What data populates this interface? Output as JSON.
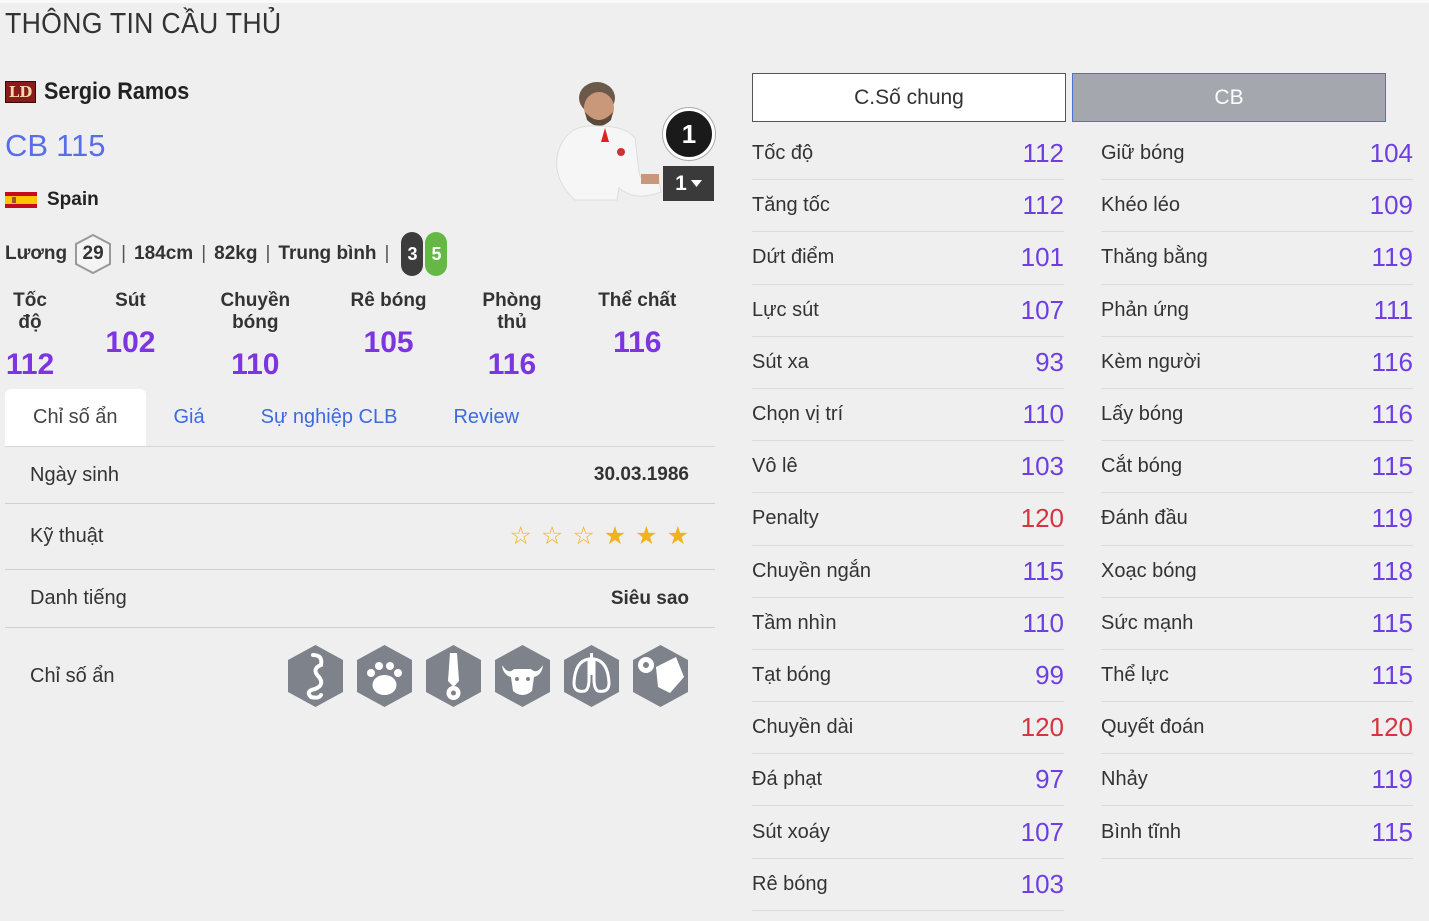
{
  "page_title": "THÔNG TIN CẦU THỦ",
  "player": {
    "season_badge": "LD",
    "name": "Sergio Ramos",
    "position": "CB",
    "ovr": "115",
    "nation": "Spain",
    "wage_label": "Lương",
    "wage": "29",
    "height": "184cm",
    "weight": "82kg",
    "build": "Trung bình",
    "left_foot": "3",
    "right_foot": "5",
    "grade": "1",
    "grade_select": "1"
  },
  "summary": [
    {
      "label": "Tốc độ",
      "value": "112"
    },
    {
      "label": "Sút",
      "value": "102"
    },
    {
      "label": "Chuyền bóng",
      "value": "110"
    },
    {
      "label": "Rê bóng",
      "value": "105"
    },
    {
      "label": "Phòng thủ",
      "value": "116"
    },
    {
      "label": "Thể chất",
      "value": "116"
    }
  ],
  "tabs": [
    "Chỉ số ẩn",
    "Giá",
    "Sự nghiệp CLB",
    "Review"
  ],
  "details": {
    "birth_label": "Ngày sinh",
    "birth_value": "30.03.1986",
    "skill_label": "Kỹ thuật",
    "skill_stars": 3,
    "skill_max": 6,
    "fame_label": "Danh tiếng",
    "fame_value": "Siêu sao",
    "traits_label": "Chỉ số ẩn",
    "traits": [
      "snake-trait-icon",
      "paw-trait-icon",
      "tie-ball-trait-icon",
      "bison-trait-icon",
      "lungs-trait-icon",
      "boot-ball-trait-icon"
    ]
  },
  "position_buttons": {
    "general": "C.Số chung",
    "cb": "CB"
  },
  "stats_left": [
    {
      "name": "Tốc độ",
      "value": "112"
    },
    {
      "name": "Tăng tốc",
      "value": "112"
    },
    {
      "name": "Dứt điểm",
      "value": "101"
    },
    {
      "name": "Lực sút",
      "value": "107"
    },
    {
      "name": "Sút xa",
      "value": "93"
    },
    {
      "name": "Chọn vị trí",
      "value": "110"
    },
    {
      "name": "Vô lê",
      "value": "103"
    },
    {
      "name": "Penalty",
      "value": "120"
    },
    {
      "name": "Chuyền ngắn",
      "value": "115"
    },
    {
      "name": "Tầm nhìn",
      "value": "110"
    },
    {
      "name": "Tạt bóng",
      "value": "99"
    },
    {
      "name": "Chuyền dài",
      "value": "120"
    },
    {
      "name": "Đá phạt",
      "value": "97"
    },
    {
      "name": "Sút xoáy",
      "value": "107"
    },
    {
      "name": "Rê bóng",
      "value": "103"
    }
  ],
  "stats_right": [
    {
      "name": "Giữ bóng",
      "value": "104"
    },
    {
      "name": "Khéo léo",
      "value": "109"
    },
    {
      "name": "Thăng bằng",
      "value": "119"
    },
    {
      "name": "Phản ứng",
      "value": "111"
    },
    {
      "name": "Kèm người",
      "value": "116"
    },
    {
      "name": "Lấy bóng",
      "value": "116"
    },
    {
      "name": "Cắt bóng",
      "value": "115"
    },
    {
      "name": "Đánh đầu",
      "value": "119"
    },
    {
      "name": "Xoạc bóng",
      "value": "118"
    },
    {
      "name": "Sức mạnh",
      "value": "115"
    },
    {
      "name": "Thể lực",
      "value": "115"
    },
    {
      "name": "Quyết đoán",
      "value": "120"
    },
    {
      "name": "Nhảy",
      "value": "119"
    },
    {
      "name": "Bình tĩnh",
      "value": "115"
    }
  ],
  "colors": {
    "stat": "#6e3fe0",
    "stat_high": "#d63440",
    "summary": "#7c35e0",
    "tab_link": "#3c6be0",
    "star": "#f2b21b"
  }
}
